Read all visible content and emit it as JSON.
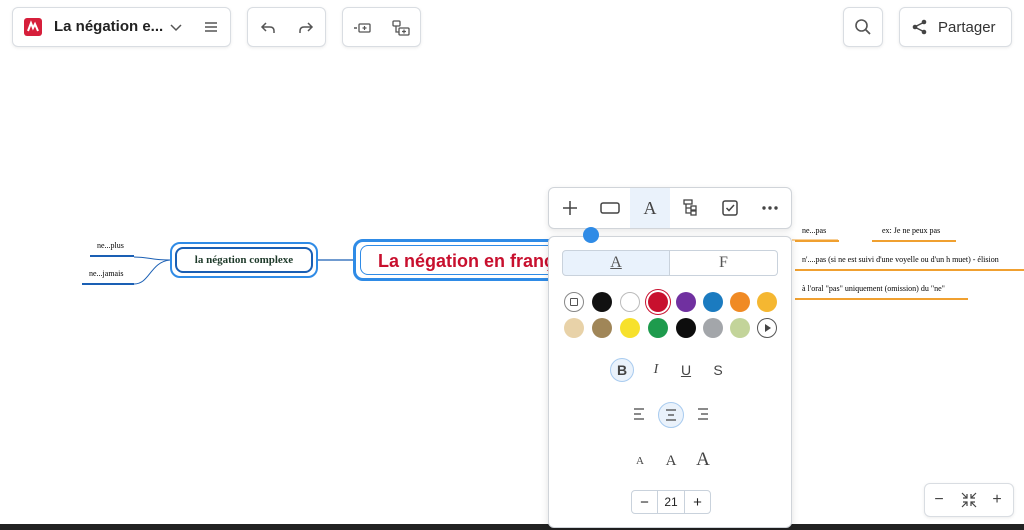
{
  "header": {
    "doc_title": "La négation e...",
    "share_label": "Partager"
  },
  "mindmap": {
    "central": "La négation en franç",
    "sub_node": "la négation complexe",
    "left_leaves": [
      "ne...plus",
      "ne...jamais"
    ],
    "right_items": [
      "ne...pas",
      "ex: Je ne peux pas",
      "n'....pas (si ne est suivi d'une voyelle ou d'un h muet) - élision",
      "à l'oral \"pas\" uniquement (omission) du \"ne\""
    ]
  },
  "format_panel": {
    "tab_a": "A",
    "tab_f": "F",
    "font_size": "21",
    "bold": "B",
    "italic": "I",
    "underline": "U",
    "strike": "S",
    "size_small": "A",
    "size_medium": "A",
    "size_large": "A",
    "minus": "−",
    "plus": "+",
    "colors_row1": [
      "none",
      "#111111",
      "#ffffff",
      "#c8102e",
      "#7030a0",
      "#1b7bc0",
      "#f08a24",
      "#f5b731"
    ],
    "colors_row2": [
      "#e8d2a8",
      "#a08658",
      "#f7e12c",
      "#1e9b4d",
      "#0d0d0d",
      "#a3a6aa",
      "#c3d49a",
      "play"
    ]
  },
  "zoom": {
    "minus": "−",
    "plus": "+"
  },
  "colors": {
    "accent_blue": "#2f8be6",
    "central_text": "#c8102e",
    "orange_line": "#f0a030"
  }
}
